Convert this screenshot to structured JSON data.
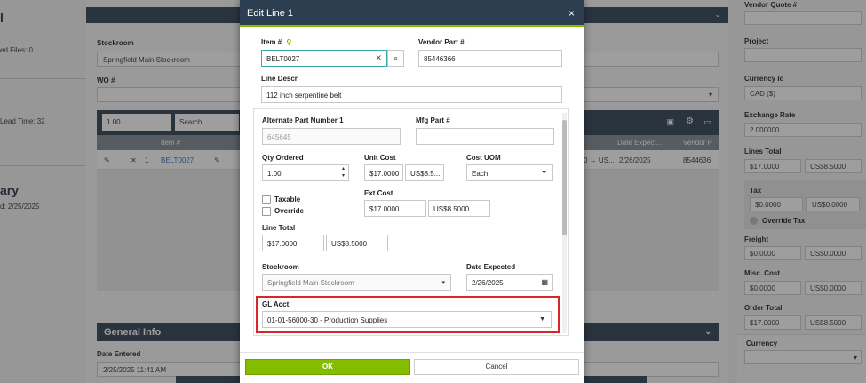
{
  "left_panel": {
    "title_partial": "l",
    "files_text": "ed Files: 0",
    "lead_time_text": "Lead Time: 32",
    "summary_partial": "ary",
    "date_text": "d: 2/25/2025"
  },
  "main": {
    "stockroom_label": "Stockroom",
    "stockroom_value": "Springfield Main Stockroom",
    "wo_label": "WO #",
    "qty_filter": "1.00",
    "search_placeholder": "Search...",
    "grid_headers": {
      "item": "Item #",
      "date_expected": "Date Expect...",
      "vendor": "Vendor P"
    },
    "grid_row": {
      "index": "1",
      "item": "BELT0027",
      "ship": "0 → US...",
      "date": "2/26/2025",
      "vendor": "8544636"
    },
    "general_info": "General Info",
    "date_entered_label": "Date Entered",
    "date_entered_value": "2/25/2025 11:41 AM"
  },
  "right_panel": {
    "vendor_quote_label": "Vendor Quote #",
    "project_label": "Project",
    "currency_id_label": "Currency Id",
    "currency_id_value": "CAD ($)",
    "exchange_rate_label": "Exchange Rate",
    "exchange_rate_value": "2.000000",
    "lines_total_label": "Lines Total",
    "lines_total_cad": "$17.0000",
    "lines_total_usd": "US$8.5000",
    "tax_label": "Tax",
    "tax_cad": "$0.0000",
    "tax_usd": "US$0.0000",
    "override_tax_label": "Override Tax",
    "freight_label": "Freight",
    "freight_cad": "$0.0000",
    "freight_usd": "US$0.0000",
    "misc_cost_label": "Misc. Cost",
    "misc_cad": "$0.0000",
    "misc_usd": "US$0.0000",
    "order_total_label": "Order Total",
    "order_total_cad": "$17.0000",
    "order_total_usd": "US$8.5000",
    "currency_label": "Currency"
  },
  "modal": {
    "title": "Edit Line 1",
    "close_glyph": "×",
    "item_label": "Item #",
    "item_value": "BELT0027",
    "vendor_part_label": "Vendor Part #",
    "vendor_part_value": "85446366",
    "line_descr_label": "Line Descr",
    "line_descr_value": "112 inch serpentine belt",
    "alt_part_label": "Alternate Part Number 1",
    "alt_part_value": "645645",
    "mfg_part_label": "Mfg Part #",
    "mfg_part_value": "",
    "qty_ordered_label": "Qty Ordered",
    "qty_ordered_value": "1.00",
    "unit_cost_label": "Unit Cost",
    "unit_cost_cad": "$17.0000",
    "unit_cost_usd": "US$8.5...",
    "cost_uom_label": "Cost UOM",
    "cost_uom_value": "Each",
    "taxable_label": "Taxable",
    "override_label": "Override",
    "ext_cost_label": "Ext Cost",
    "ext_cost_cad": "$17.0000",
    "ext_cost_usd": "US$8.5000",
    "line_total_label": "Line Total",
    "line_total_cad": "$17.0000",
    "line_total_usd": "US$8.5000",
    "stockroom_label": "Stockroom",
    "stockroom_value": "Springfield Main Stockroom",
    "date_expected_label": "Date Expected",
    "date_expected_value": "2/26/2025",
    "gl_acct_label": "GL Acct",
    "gl_acct_value": "01-01-56000-30 - Production Supplies",
    "ok_label": "OK",
    "cancel_label": "Cancel"
  },
  "colors": {
    "header_navy": "#2d3e50",
    "accent_green": "#84bd00",
    "highlight_red": "#d9262c"
  }
}
